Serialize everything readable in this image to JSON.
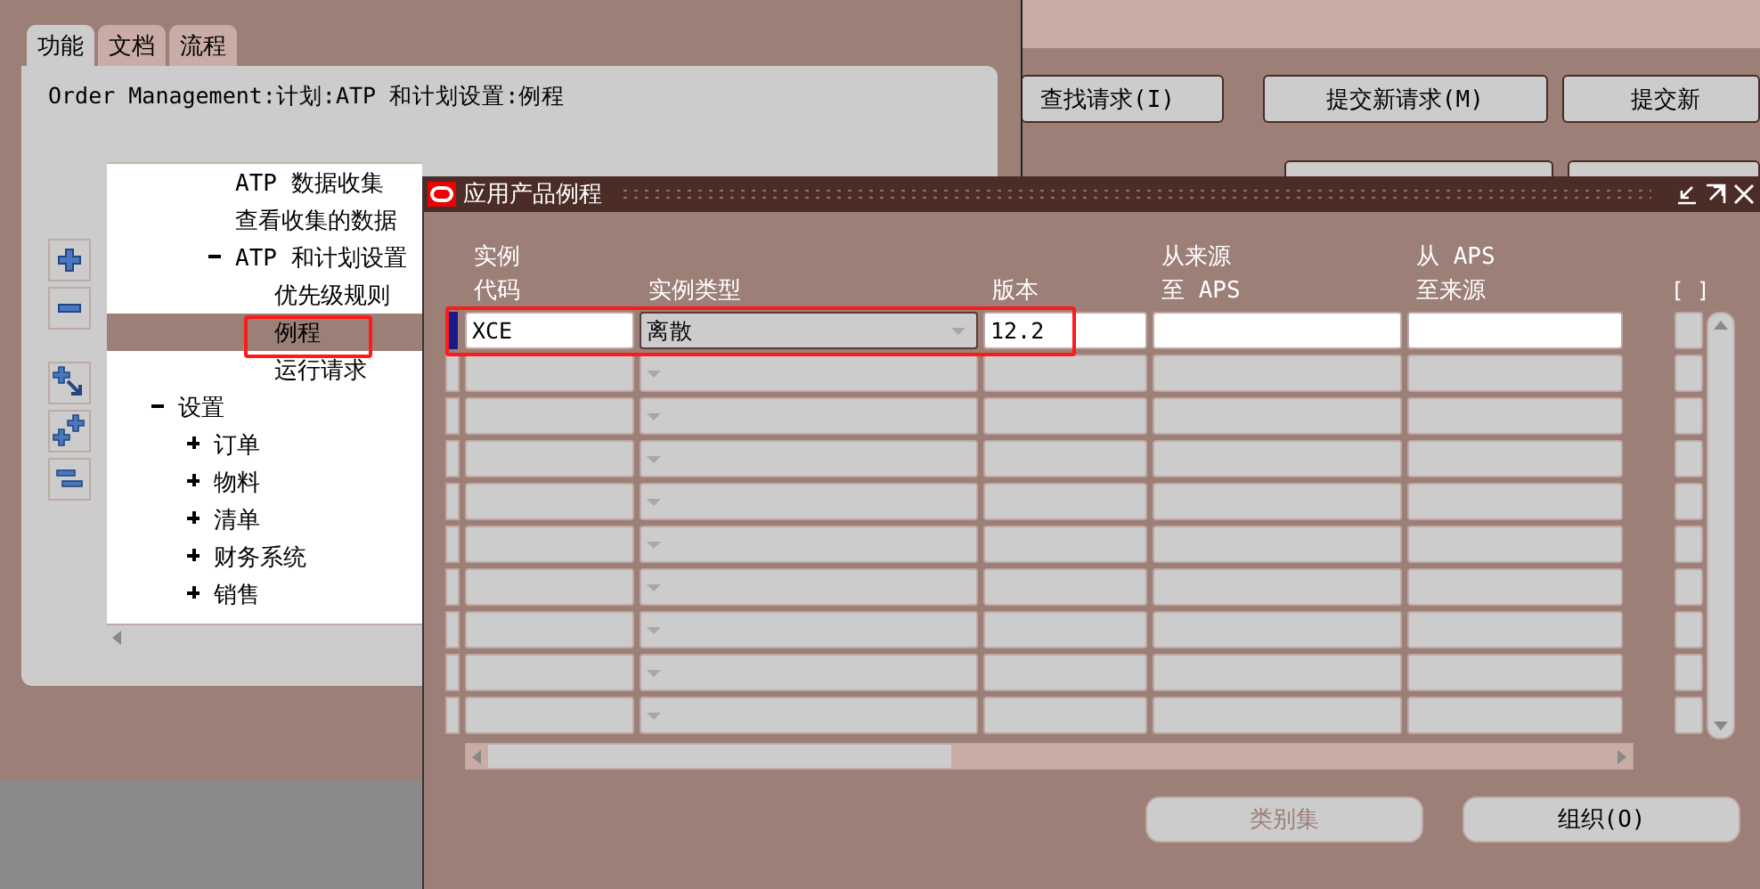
{
  "navigator": {
    "tabs": [
      {
        "label": "功能",
        "selected": true
      },
      {
        "label": "文档",
        "selected": false
      },
      {
        "label": "流程",
        "selected": false
      }
    ],
    "path": "Order Management:计划:ATP 和计划设置:例程",
    "tree": {
      "continued_children": [
        {
          "label": "ATP 数据收集"
        },
        {
          "label": "查看收集的数据"
        },
        {
          "label": "ATP 和计划设置",
          "expanded": true,
          "children": [
            {
              "label": "优先级规则",
              "selected": false
            },
            {
              "label": "例程",
              "selected": true
            },
            {
              "label": "运行请求",
              "selected": false
            }
          ]
        }
      ],
      "items": [
        {
          "label": "设置",
          "expanded": true,
          "children": [
            {
              "label": "订单",
              "expanded": false
            },
            {
              "label": "物料",
              "expanded": false
            },
            {
              "label": "清单",
              "expanded": false
            },
            {
              "label": "财务系统",
              "expanded": false
            },
            {
              "label": "销售",
              "expanded": false
            }
          ]
        }
      ]
    }
  },
  "requests": {
    "buttons": [
      {
        "label": "查找请求(I)"
      },
      {
        "label": "提交新请求(M)"
      },
      {
        "label": "提交新"
      }
    ]
  },
  "dialog": {
    "title": "应用产品例程",
    "columns": [
      {
        "line1": "实例",
        "line2": "代码"
      },
      {
        "line2": "实例类型"
      },
      {
        "line2": "版本"
      },
      {
        "line1": "从来源",
        "line2": "至 APS"
      },
      {
        "line1": "从 APS",
        "line2": "至来源"
      }
    ],
    "column_6": "[ ]",
    "rows": [
      {
        "current": true,
        "code": "XCE",
        "type": "离散",
        "version": "12.2"
      }
    ],
    "buttons": [
      {
        "label": "类别集",
        "disabled": true
      },
      {
        "label": "组织(O)",
        "disabled": false
      }
    ]
  }
}
